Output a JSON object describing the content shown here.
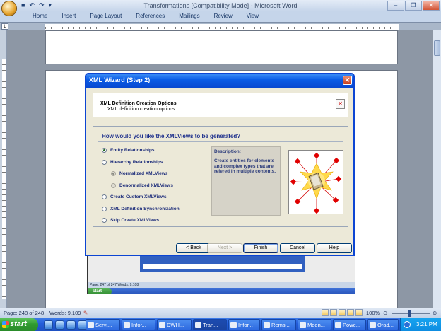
{
  "window": {
    "title": "Transformations [Compatibility Mode] - Microsoft Word",
    "qat_icons": [
      "save-icon",
      "undo-icon",
      "redo-icon",
      "customize-icon"
    ],
    "controls": [
      "–",
      "❐",
      "✕"
    ]
  },
  "ribbon": {
    "tabs": [
      "Home",
      "Insert",
      "Page Layout",
      "References",
      "Mailings",
      "Review",
      "View"
    ]
  },
  "dialog": {
    "title": "XML Wizard (Step 2)",
    "close_glyph": "✕",
    "header_title": "XML Definition Creation Options",
    "header_subtitle": "XML definition creation options.",
    "header_icon_glyph": "✕",
    "question": "How would you like the XMLViews to be generated?",
    "options": [
      {
        "label": "Entity Relationships",
        "selected": true,
        "enabled": true,
        "indent": 0
      },
      {
        "label": "Hierarchy Relationships",
        "selected": false,
        "enabled": true,
        "indent": 0
      },
      {
        "label": "Normalized XMLViews",
        "selected": true,
        "enabled": false,
        "indent": 1
      },
      {
        "label": "Denormalized XMLViews",
        "selected": false,
        "enabled": false,
        "indent": 1
      },
      {
        "label": "Create Custom XMLViews",
        "selected": false,
        "enabled": true,
        "indent": 0
      },
      {
        "label": "XML Definition Synchronization",
        "selected": false,
        "enabled": true,
        "indent": 0
      },
      {
        "label": "Skip Create XMLViews",
        "selected": false,
        "enabled": true,
        "indent": 0
      }
    ],
    "description_title": "Description:",
    "description_text": "Create entities for elements and complex types that are refered in multiple contents.",
    "buttons": {
      "back": "< Back",
      "next": "Next >",
      "finish": "Finish",
      "cancel": "Cancel",
      "help": "Help"
    }
  },
  "inner_screenshot": {
    "status": "Page: 247 of 247   Words: 9,108",
    "start": "start"
  },
  "statusbar": {
    "page": "Page: 248 of 248",
    "words": "Words: 9,109",
    "zoom": "100%"
  },
  "taskbar": {
    "start_label": "start",
    "tasks": [
      {
        "label": "Servi...",
        "active": false
      },
      {
        "label": "Infor...",
        "active": false
      },
      {
        "label": "DWH...",
        "active": false
      },
      {
        "label": "Tran...",
        "active": true
      },
      {
        "label": "Infor...",
        "active": false
      },
      {
        "label": "Rems...",
        "active": false
      },
      {
        "label": "Meen...",
        "active": false
      },
      {
        "label": "Powe...",
        "active": false
      },
      {
        "label": "Orad...",
        "active": false
      }
    ],
    "clock": "3:21 PM"
  },
  "colors": {
    "dialog_title": "#0a5ce6",
    "option_text": "#1c2c7a",
    "taskbar": "#245edb",
    "start": "#2f9a2f"
  }
}
